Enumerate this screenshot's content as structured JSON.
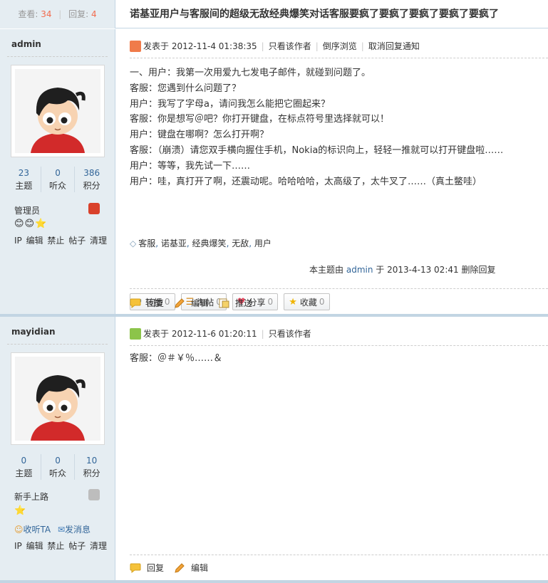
{
  "header": {
    "views_label": "查看:",
    "views": "34",
    "replies_label": "回复:",
    "replies": "4",
    "title": "诺基亚用户与客服间的超级无敌经典爆笑对话客服要疯了要疯了要疯了要疯了要疯了"
  },
  "posts": [
    {
      "author": "admin",
      "stats": [
        {
          "value": "23",
          "label": "主题"
        },
        {
          "value": "0",
          "label": "听众"
        },
        {
          "value": "386",
          "label": "积分"
        }
      ],
      "rank": "管理员",
      "stars": "😊😊⭐",
      "mod_ops": "IP 编辑 禁止 帖子 清理",
      "posted_prefix": "发表于",
      "posted_time": "2012-11-4 01:38:35",
      "meta_links": [
        "只看该作者",
        "倒序浏览",
        "取消回复通知"
      ],
      "content": "一、用户：我第一次用爱九七发电子邮件，就碰到问题了。\n客服：您遇到什么问题了？\n用户：我写了字母a，请问我怎么能把它圈起来？\n客服：你是想写＠吧？你打开键盘，在标点符号里选择就可以！\n用户：键盘在哪啊？怎么打开啊？\n客服：（崩溃）请您双手横向握住手机，Nokia的标识向上，轻轻一推就可以打开键盘啦……\n用户：等等，我先试一下……\n用户：哇，真打开了啊，还震动呢。哈哈哈哈，太高级了，太牛叉了……（真土鳖哇）",
      "tags": [
        "客服",
        "诺基亚",
        "经典爆笑",
        "无敌",
        "用户"
      ],
      "edited_prefix": "本主题由",
      "edited_author": "admin",
      "edited_mid": "于",
      "edited_time": "2013-4-13 02:41",
      "edited_action": "删除回复",
      "share": [
        {
          "icon": "↗",
          "label": "转播",
          "count": "0"
        },
        {
          "icon": "☰",
          "label": "淘帖",
          "count": "0"
        },
        {
          "icon": "♥",
          "label": "分享",
          "count": "0"
        },
        {
          "icon": "★",
          "label": "收藏",
          "count": "0"
        }
      ],
      "actions": [
        "回复",
        "编辑",
        "推送"
      ]
    },
    {
      "author": "mayidian",
      "stats": [
        {
          "value": "0",
          "label": "主题"
        },
        {
          "value": "0",
          "label": "听众"
        },
        {
          "value": "10",
          "label": "积分"
        }
      ],
      "rank": "新手上路",
      "stars": "⭐",
      "follow": "收听TA",
      "message": "发消息",
      "mod_ops": "IP 编辑 禁止 帖子 清理",
      "posted_prefix": "发表于",
      "posted_time": "2012-11-6 01:20:11",
      "meta_links": [
        "只看该作者"
      ],
      "content": "客服：＠＃￥％……＆",
      "actions": [
        "回复",
        "编辑"
      ]
    }
  ],
  "colors": {
    "side_bg": "#e5edf2",
    "border": "#c2d5e3",
    "link": "#336699",
    "count_red": "#f26c4f"
  }
}
